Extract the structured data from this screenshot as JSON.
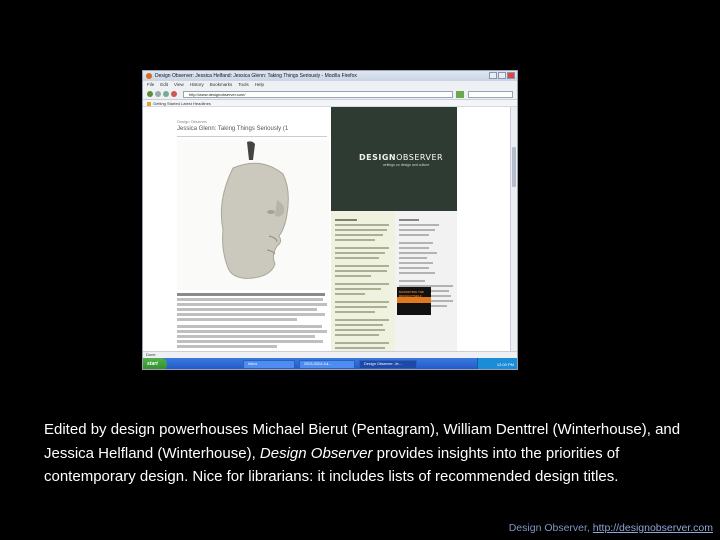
{
  "browser": {
    "title": "Design Observer: Jessica Helfand: Jessica Glenn: Taking Things Seriously - Mozilla Firefox",
    "menu": [
      "File",
      "Edit",
      "View",
      "History",
      "Bookmarks",
      "Tools",
      "Help"
    ],
    "address": "http://www.designobserver.com/",
    "bookmarks": "Getting Started   Latest Headlines",
    "status": "Done",
    "page": {
      "kicker": "Design Observer",
      "headline": "Jessica Glenn: Taking Things Seriously (1",
      "logo_design": "DESIGN",
      "logo_observer": "OBSERVER",
      "logo_tag": "writings on design and culture",
      "book_label": "MARKETING THE DESIGN ITSELF"
    },
    "taskbar": {
      "start": "start",
      "items": [
        "Inbox",
        "2003-0024-Jul...",
        "Design Observer: Je..."
      ],
      "tray": "12:00 PM"
    }
  },
  "caption": {
    "text_before": "Edited by design powerhouses Michael Bierut (Pentagram), William Denttrel (Winterhouse), and Jessica Helfland (Winterhouse), ",
    "italic": "Design Observer",
    "text_after": " provides insights into the priorities of contemporary design.  Nice for librarians: it includes lists of recommended design titles."
  },
  "footer": {
    "label": "Design Observer, ",
    "url": "http://designobserver.com"
  }
}
